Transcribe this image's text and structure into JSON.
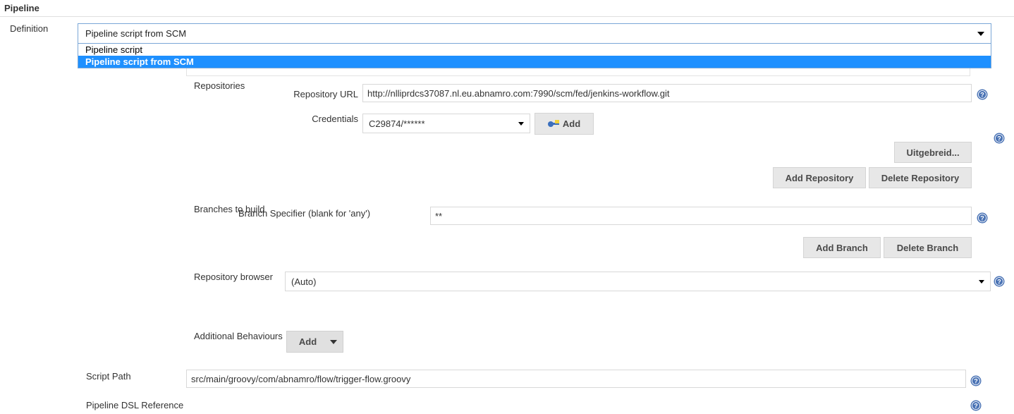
{
  "section": {
    "title": "Pipeline"
  },
  "definition": {
    "label": "Definition",
    "selected": "Pipeline script from SCM",
    "options": [
      {
        "label": "Pipeline script",
        "selected": false
      },
      {
        "label": "Pipeline script from SCM",
        "selected": true
      }
    ]
  },
  "repositories": {
    "label": "Repositories",
    "url": {
      "label": "Repository URL",
      "value": "http://nlliprdcs37087.nl.eu.abnamro.com:7990/scm/fed/jenkins-workflow.git"
    },
    "credentials": {
      "label": "Credentials",
      "value": "C29874/******",
      "add_label": "Add",
      "add_icon": "key-icon"
    },
    "advanced_label": "Uitgebreid...",
    "add_repository_label": "Add Repository",
    "delete_repository_label": "Delete Repository"
  },
  "branches": {
    "label": "Branches to build",
    "specifier": {
      "label": "Branch Specifier (blank for 'any')",
      "value": "**"
    },
    "add_branch_label": "Add Branch",
    "delete_branch_label": "Delete Branch"
  },
  "repository_browser": {
    "label": "Repository browser",
    "value": "(Auto)"
  },
  "additional_behaviours": {
    "label": "Additional Behaviours",
    "add_label": "Add"
  },
  "script_path": {
    "label": "Script Path",
    "value": "src/main/groovy/com/abnamro/flow/trigger-flow.groovy"
  },
  "dsl_reference": {
    "label": "Pipeline DSL Reference"
  },
  "help_icon": "help-icon",
  "colors": {
    "highlight": "#1e90ff",
    "help_blue": "#4a73b5",
    "focus_border": "#7ba7d7",
    "button_face": "#e7e7e7"
  }
}
